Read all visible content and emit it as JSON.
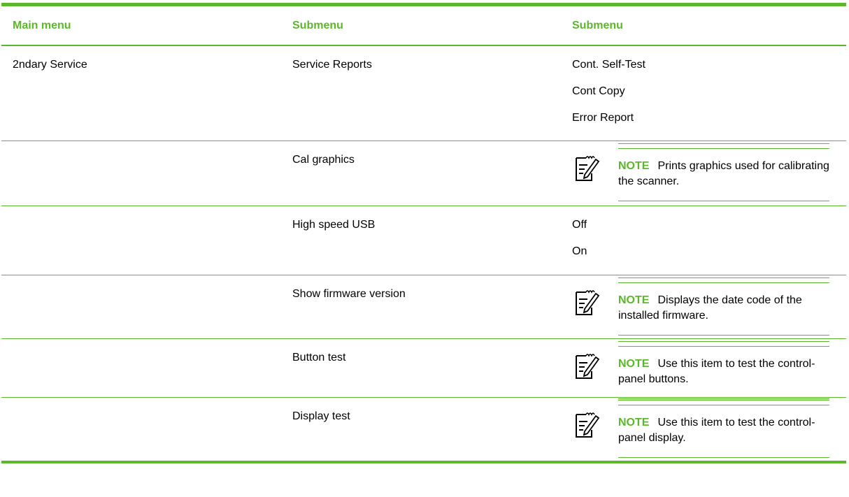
{
  "header": {
    "col1": "Main menu",
    "col2": "Submenu",
    "col3": "Submenu"
  },
  "rows": [
    {
      "main": "2ndary Service",
      "sub": "Service Reports",
      "items": [
        "Cont. Self-Test",
        "Cont Copy",
        "Error Report"
      ]
    },
    {
      "main": "",
      "sub": "Cal graphics",
      "note": {
        "label": "NOTE",
        "text": "Prints graphics used for calibrating the scanner."
      }
    },
    {
      "main": "",
      "sub": "High speed USB",
      "items": [
        "Off",
        "On"
      ]
    },
    {
      "main": "",
      "sub": "Show firmware version",
      "note": {
        "label": "NOTE",
        "text": "Displays the date code of the installed firmware."
      }
    },
    {
      "main": "",
      "sub": "Button test",
      "note": {
        "label": "NOTE",
        "text": "Use this item to test the control-panel buttons."
      }
    },
    {
      "main": "",
      "sub": "Display test",
      "note": {
        "label": "NOTE",
        "text": "Use this item to test the control-panel display."
      }
    }
  ],
  "icons": {
    "note": "note-pencil-icon"
  },
  "colors": {
    "accent": "#5cb82b"
  }
}
